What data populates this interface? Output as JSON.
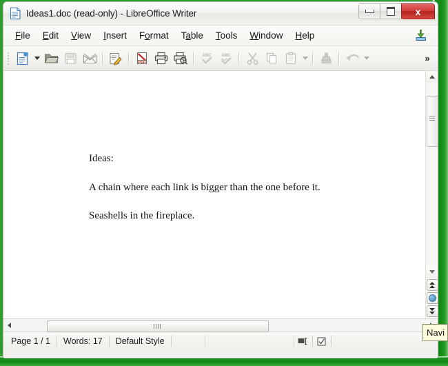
{
  "window": {
    "title": "Ideas1.doc (read-only) - LibreOffice Writer",
    "app_icon": "document-icon",
    "controls": {
      "minimize": "minimize-button",
      "maximize": "maximize-button",
      "close_label": "x"
    }
  },
  "menubar": {
    "items": [
      {
        "label": "File",
        "accel": "F"
      },
      {
        "label": "Edit",
        "accel": "E"
      },
      {
        "label": "View",
        "accel": "V"
      },
      {
        "label": "Insert",
        "accel": "I"
      },
      {
        "label": "Format",
        "accel": "o"
      },
      {
        "label": "Table",
        "accel": "a"
      },
      {
        "label": "Tools",
        "accel": "T"
      },
      {
        "label": "Window",
        "accel": "W"
      },
      {
        "label": "Help",
        "accel": "H"
      }
    ],
    "right_icon": "download-import-icon"
  },
  "toolbar": {
    "overflow_label": "»",
    "buttons": [
      {
        "name": "new-document-button",
        "icon": "new-document-icon",
        "enabled": true,
        "dropdown": true
      },
      {
        "name": "open-button",
        "icon": "open-folder-icon",
        "enabled": true
      },
      {
        "name": "save-button",
        "icon": "save-floppy-icon",
        "enabled": false
      },
      {
        "name": "email-button",
        "icon": "email-envelope-icon",
        "enabled": true
      },
      {
        "name": "edit-mode-button",
        "icon": "edit-pencil-icon",
        "enabled": true
      },
      {
        "name": "export-pdf-button",
        "icon": "pdf-icon",
        "enabled": true
      },
      {
        "name": "print-button",
        "icon": "printer-icon",
        "enabled": true
      },
      {
        "name": "print-preview-button",
        "icon": "print-preview-icon",
        "enabled": true
      },
      {
        "name": "spelling-button",
        "icon": "spellcheck-abc-icon",
        "enabled": false
      },
      {
        "name": "autospellcheck-button",
        "icon": "autospellcheck-abc-icon",
        "enabled": false
      },
      {
        "name": "cut-button",
        "icon": "scissors-icon",
        "enabled": false
      },
      {
        "name": "copy-button",
        "icon": "copy-pages-icon",
        "enabled": false
      },
      {
        "name": "paste-button",
        "icon": "clipboard-icon",
        "enabled": false,
        "dropdown": true
      },
      {
        "name": "clone-formatting-button",
        "icon": "paintbrush-icon",
        "enabled": false
      },
      {
        "name": "undo-button",
        "icon": "undo-arrow-icon",
        "enabled": false,
        "dropdown": true
      }
    ]
  },
  "document": {
    "paragraphs": [
      "Ideas:",
      "A chain where each link is bigger than the one before it.",
      "Seashells in the fireplace."
    ]
  },
  "scrollbars": {
    "vertical": {
      "up_arrow": "scroll-up-arrow",
      "down_arrow": "scroll-down-arrow",
      "previous_page": "previous-page-button",
      "navigation": "navigation-button",
      "next_page": "next-page-button"
    },
    "horizontal": {
      "left_arrow": "scroll-left-arrow",
      "right_arrow": "scroll-right-arrow"
    }
  },
  "statusbar": {
    "page": "Page 1 / 1",
    "words": "Words: 17",
    "style": "Default Style",
    "selection_icon": "selection-mode-icon",
    "modified_icon": "document-modified-icon"
  },
  "tooltip": {
    "text": "Navi"
  },
  "colors": {
    "desktop_green": "#1d8f1d",
    "close_red": "#c23a33",
    "title_bar": "#f2f2ee",
    "accent_blue": "#5e9ed0"
  }
}
